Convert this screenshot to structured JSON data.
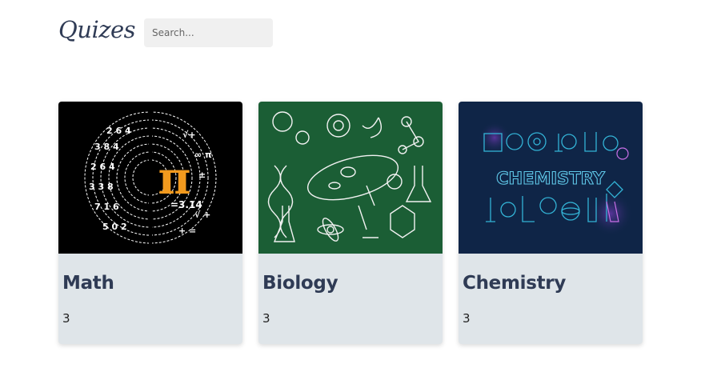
{
  "header": {
    "title": "Quizes",
    "search_placeholder": "Search..."
  },
  "quizzes": [
    {
      "title": "Math",
      "count": "3",
      "image_icon": "pi-spiral-image",
      "image_text": [
        "=3.14"
      ]
    },
    {
      "title": "Biology",
      "count": "3",
      "image_icon": "cell-doodle-image"
    },
    {
      "title": "Chemistry",
      "count": "3",
      "image_icon": "chemistry-lab-image",
      "image_text": [
        "CHEMISTRY"
      ]
    }
  ],
  "colors": {
    "title": "#2f3b55",
    "card_bg": "#dfe5e9",
    "search_bg": "#f0f0f0",
    "math_bg": "#000000",
    "biology_bg": "#1b5e35",
    "chemistry_bg": "#0f2547",
    "pi_orange": "#f29a1e"
  }
}
